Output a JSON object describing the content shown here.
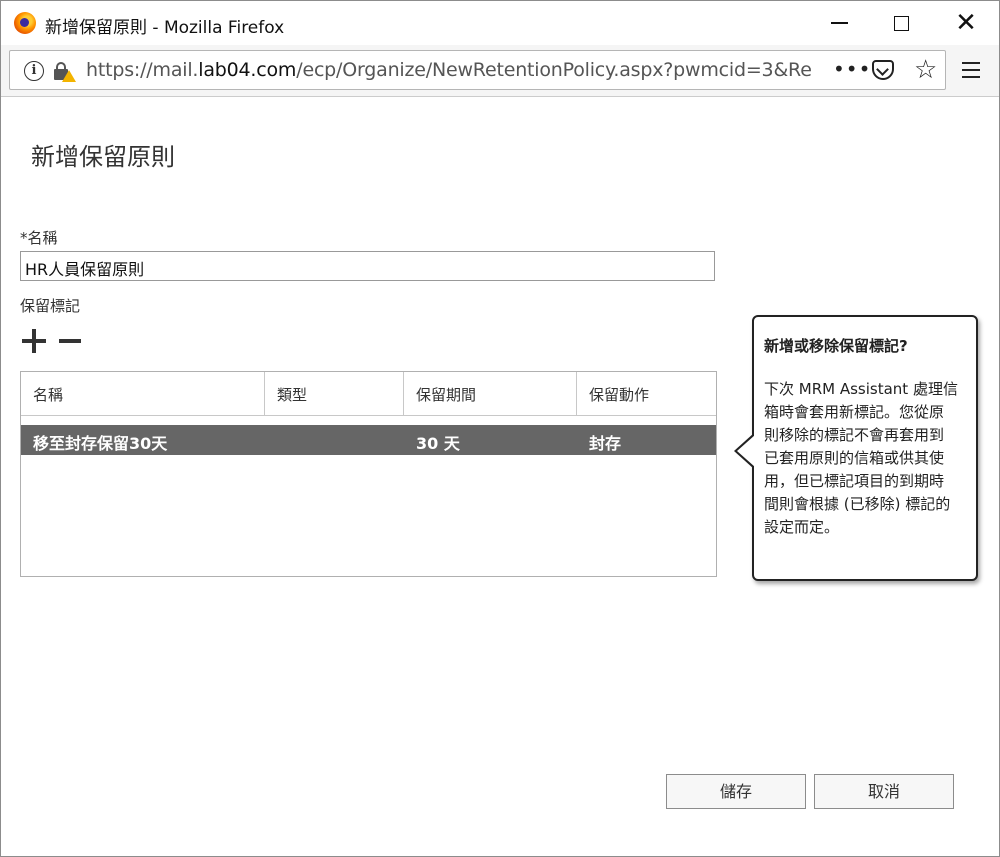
{
  "window": {
    "title": "新增保留原則 - Mozilla Firefox"
  },
  "urlbar": {
    "url_prefix": "https://mail.",
    "url_domain": "lab04.com",
    "url_path": "/ecp/Organize/NewRetentionPolicy.aspx?pwmcid=3&Re",
    "more_label": "•••"
  },
  "page": {
    "title": "新增保留原則",
    "name_label": "*名稱",
    "name_value": "HR人員保留原則",
    "tags_label": "保留標記"
  },
  "grid": {
    "columns": [
      "名稱",
      "類型",
      "保留期間",
      "保留動作"
    ],
    "rows": [
      {
        "name": "移至封存保留30天",
        "type": "",
        "period": "30 天",
        "action": "封存"
      }
    ]
  },
  "callout": {
    "title": "新增或移除保留標記?",
    "body_lines": [
      "下次 MRM Assistant 處理信",
      "箱時會套用新標記。您從原",
      "則移除的標記不會再套用到",
      "已套用原則的信箱或供其使",
      "用，但已標記項目的到期時",
      "間則會根據 (已移除) 標記的",
      "設定而定。"
    ]
  },
  "buttons": {
    "save": "儲存",
    "cancel": "取消"
  }
}
